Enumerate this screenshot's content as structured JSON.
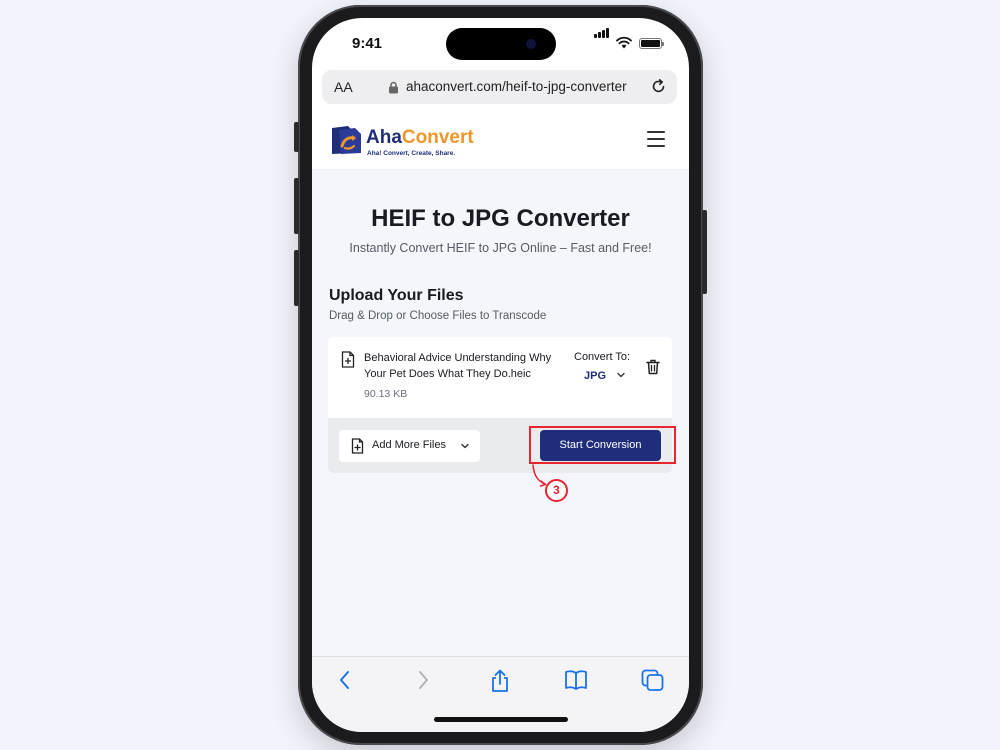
{
  "status_bar": {
    "time": "9:41"
  },
  "browser": {
    "text_size_label": "AA",
    "url": "ahaconvert.com/heif-to-jpg-converter"
  },
  "site": {
    "logo_part1": "Aha",
    "logo_part2": "Convert",
    "tagline": "Aha! Convert, Create, Share."
  },
  "page": {
    "title": "HEIF to JPG Converter",
    "subtitle": "Instantly Convert HEIF to JPG Online – Fast and Free!"
  },
  "upload": {
    "title": "Upload Your Files",
    "subtitle": "Drag & Drop or Choose Files to Transcode",
    "file": {
      "name": "Behavioral Advice Understanding Why Your Pet Does What They Do.heic",
      "size": "90.13 KB",
      "convert_to_label": "Convert To:",
      "format": "JPG"
    },
    "add_more_label": "Add More Files",
    "start_label": "Start Conversion"
  },
  "annotation": {
    "step": "3",
    "color": "#e8262f"
  },
  "colors": {
    "brand_navy": "#1f2e7a",
    "brand_orange": "#f0962a"
  },
  "toolbar_icons": [
    "back-icon",
    "forward-icon",
    "share-icon",
    "bookmarks-icon",
    "tabs-icon"
  ]
}
